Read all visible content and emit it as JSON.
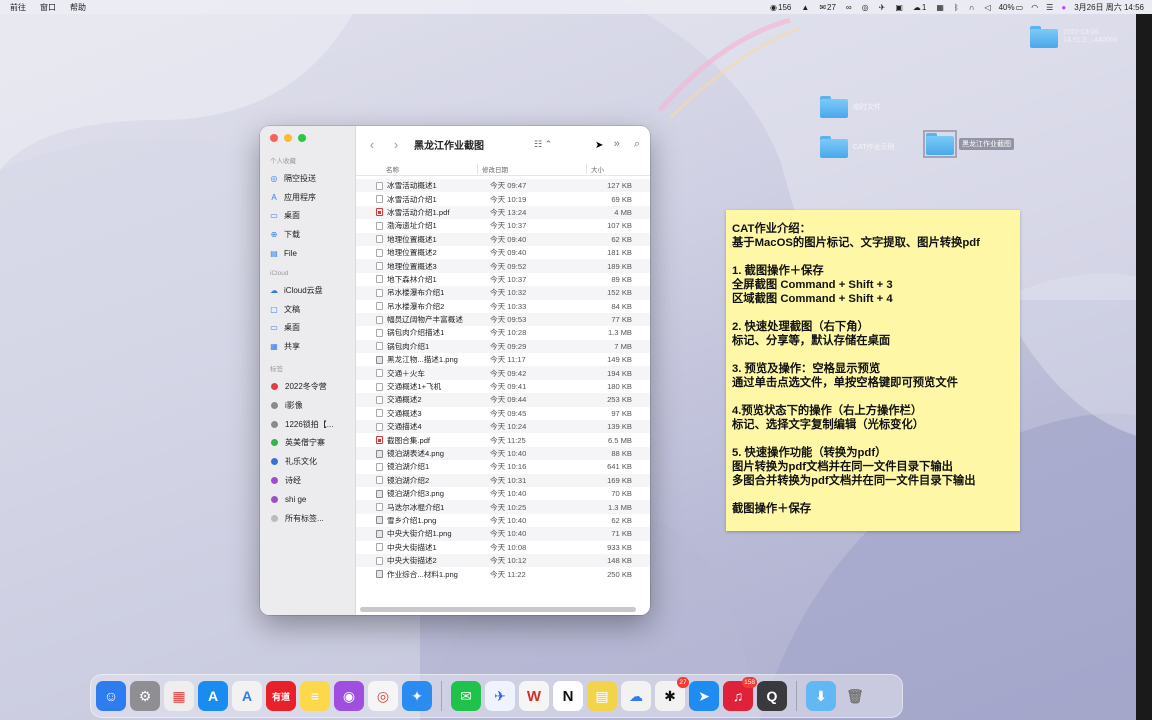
{
  "menubar": {
    "left": [
      "前往",
      "窗口",
      "帮助"
    ],
    "right": [
      {
        "icon": "media-icon",
        "text": "156"
      },
      {
        "icon": "bell-icon",
        "text": ""
      },
      {
        "icon": "mail-icon",
        "text": "27"
      },
      {
        "icon": "link-icon",
        "text": ""
      },
      {
        "icon": "record-icon",
        "text": ""
      },
      {
        "icon": "bird-icon",
        "text": ""
      },
      {
        "icon": "gamepad-icon",
        "text": ""
      },
      {
        "icon": "chat-icon",
        "text": "1"
      },
      {
        "icon": "screen-icon",
        "text": ""
      },
      {
        "icon": "bluetooth-icon",
        "text": ""
      },
      {
        "icon": "headphones-icon",
        "text": ""
      },
      {
        "icon": "volume-icon",
        "text": ""
      }
    ],
    "battery": "40%",
    "datetime": "3月26日 周六  14:56"
  },
  "desktop": {
    "top_folder": {
      "line1": "2022-03-26",
      "line2": "14.51.3....440060"
    },
    "folders": [
      "临时文件",
      "CAT作业示例",
      "黑龙江作业截图"
    ]
  },
  "finder": {
    "title": "黑龙江作业截图",
    "sidebar": {
      "favorites_header": "个人收藏",
      "favorites": [
        {
          "icon": "airdrop-icon",
          "label": "隔空投送"
        },
        {
          "icon": "applications-icon",
          "label": "应用程序"
        },
        {
          "icon": "desktop-icon",
          "label": "桌面"
        },
        {
          "icon": "downloads-icon",
          "label": "下载"
        },
        {
          "icon": "file-icon",
          "label": "File"
        }
      ],
      "icloud_header": "iCloud",
      "icloud": [
        {
          "icon": "cloud-icon",
          "label": "iCloud云盘"
        },
        {
          "icon": "documents-icon",
          "label": "文稿"
        },
        {
          "icon": "desktop-icon",
          "label": "桌面"
        },
        {
          "icon": "shared-icon",
          "label": "共享"
        }
      ],
      "tags_header": "标签",
      "tags": [
        {
          "color": "#e0413a",
          "label": "2022冬令营"
        },
        {
          "color": "#8a8a8a",
          "label": "i影像"
        },
        {
          "color": "#8a8a8a",
          "label": "1226锁拍【..."
        },
        {
          "color": "#35b24a",
          "label": "英美僧宁寨"
        },
        {
          "color": "#3a6fd8",
          "label": "礼乐文化"
        },
        {
          "color": "#9b4fd0",
          "label": "诗经"
        },
        {
          "color": "#9b4fd0",
          "label": "shi ge"
        },
        {
          "color": "#bbbbbb",
          "label": "所有标签..."
        }
      ]
    },
    "columns": {
      "name": "名称",
      "date": "修改日期",
      "size": "大小"
    },
    "files": [
      {
        "type": "doc",
        "name": "冰雪活动概述1",
        "date": "今天 09:47",
        "size": "127 KB"
      },
      {
        "type": "doc",
        "name": "冰雪活动介绍1",
        "date": "今天 10:19",
        "size": "69 KB"
      },
      {
        "type": "pdf",
        "name": "冰雪活动介绍1.pdf",
        "date": "今天 13:24",
        "size": "4 MB"
      },
      {
        "type": "doc",
        "name": "渤海遗址介绍1",
        "date": "今天 10:37",
        "size": "107 KB"
      },
      {
        "type": "doc",
        "name": "地理位置概述1",
        "date": "今天 09:40",
        "size": "62 KB"
      },
      {
        "type": "doc",
        "name": "地理位置概述2",
        "date": "今天 09:40",
        "size": "181 KB"
      },
      {
        "type": "doc",
        "name": "地理位置概述3",
        "date": "今天 09:52",
        "size": "189 KB"
      },
      {
        "type": "doc",
        "name": "地下森林介绍1",
        "date": "今天 10:37",
        "size": "89 KB"
      },
      {
        "type": "doc",
        "name": "吊水楼瀑布介绍1",
        "date": "今天 10:32",
        "size": "152 KB"
      },
      {
        "type": "doc",
        "name": "吊水楼瀑布介绍2",
        "date": "今天 10:33",
        "size": "84 KB"
      },
      {
        "type": "doc",
        "name": "幅员辽阔物产丰富概述",
        "date": "今天 09:53",
        "size": "77 KB"
      },
      {
        "type": "doc",
        "name": "锅包肉介绍描述1",
        "date": "今天 10:28",
        "size": "1.3 MB"
      },
      {
        "type": "doc",
        "name": "锅包肉介绍1",
        "date": "今天 09:29",
        "size": "7 MB"
      },
      {
        "type": "png",
        "name": "黑龙江物...描述1.png",
        "date": "今天 11:17",
        "size": "149 KB"
      },
      {
        "type": "doc",
        "name": "交通＋火车",
        "date": "今天 09:42",
        "size": "194 KB"
      },
      {
        "type": "doc",
        "name": "交通概述1+飞机",
        "date": "今天 09:41",
        "size": "180 KB"
      },
      {
        "type": "doc",
        "name": "交通概述2",
        "date": "今天 09:44",
        "size": "253 KB"
      },
      {
        "type": "doc",
        "name": "交通概述3",
        "date": "今天 09:45",
        "size": "97 KB"
      },
      {
        "type": "doc",
        "name": "交通描述4",
        "date": "今天 10:24",
        "size": "139 KB"
      },
      {
        "type": "pdf",
        "name": "截图合集.pdf",
        "date": "今天 11:25",
        "size": "6.5 MB"
      },
      {
        "type": "png",
        "name": "镜泊湖表述4.png",
        "date": "今天 10:40",
        "size": "88 KB"
      },
      {
        "type": "doc",
        "name": "镜泊湖介绍1",
        "date": "今天 10:16",
        "size": "641 KB"
      },
      {
        "type": "doc",
        "name": "镜泊湖介绍2",
        "date": "今天 10:31",
        "size": "169 KB"
      },
      {
        "type": "png",
        "name": "镜泊湖介绍3.png",
        "date": "今天 10:40",
        "size": "70 KB"
      },
      {
        "type": "doc",
        "name": "马迭尔冰棍介绍1",
        "date": "今天 10:25",
        "size": "1.3 MB"
      },
      {
        "type": "png",
        "name": "雪乡介绍1.png",
        "date": "今天 10:40",
        "size": "62 KB"
      },
      {
        "type": "png",
        "name": "中央大街介绍1.png",
        "date": "今天 10:40",
        "size": "71 KB"
      },
      {
        "type": "doc",
        "name": "中央大街描述1",
        "date": "今天 10:08",
        "size": "933 KB"
      },
      {
        "type": "doc",
        "name": "中央大街描述2",
        "date": "今天 10:12",
        "size": "148 KB"
      },
      {
        "type": "png",
        "name": "作业综合...材料1.png",
        "date": "今天 11:22",
        "size": "250 KB"
      }
    ]
  },
  "note": {
    "lines": [
      "CAT作业介绍：",
      "基于MacOS的图片标记、文字提取、图片转换pdf",
      "",
      "1. 截图操作＋保存",
      "全屏截图 Command + Shift + 3",
      "区域截图 Command + Shift + 4",
      "",
      "2. 快速处理截图（右下角）",
      "标记、分享等，默认存储在桌面",
      "",
      "3. 预览及操作：空格显示预览",
      "通过单击点选文件，单按空格键即可预览文件",
      "",
      "4.预览状态下的操作（右上方操作栏）",
      "标记、选择文字复制编辑（光标变化）",
      "",
      "5. 快速操作功能（转换为pdf）",
      "图片转换为pdf文档并在同一文件目录下输出",
      "多图合并转换为pdf文档并在同一文件目录下输出",
      "",
      "截图操作＋保存"
    ]
  },
  "dock": {
    "apps": [
      {
        "name": "finder-app",
        "label": "",
        "glyph": "☺",
        "bg": "#2f7bf0"
      },
      {
        "name": "system-preferences-app",
        "label": "",
        "glyph": "⚙",
        "bg": "#8e8e93"
      },
      {
        "name": "launchpad-app",
        "label": "",
        "glyph": "▦",
        "bg": "#eeeeee",
        "fg": "#e0413a"
      },
      {
        "name": "app-store-app",
        "label": "",
        "glyph": "A",
        "bg": "#1a8cf0"
      },
      {
        "name": "translator-app",
        "label": "",
        "glyph": "A",
        "bg": "#f2f2f2",
        "fg": "#2f7bf0"
      },
      {
        "name": "youdao-app",
        "label": "有道",
        "glyph": "",
        "bg": "#e7202a"
      },
      {
        "name": "notes-app",
        "label": "",
        "glyph": "≡",
        "bg": "#fbd94b",
        "fg": "#fff"
      },
      {
        "name": "podcasts-app",
        "label": "",
        "glyph": "◉",
        "bg": "#a04ee0"
      },
      {
        "name": "chrome-app",
        "label": "",
        "glyph": "◎",
        "bg": "#f5f5f5",
        "fg": "#e0413a"
      },
      {
        "name": "safari-app",
        "label": "",
        "glyph": "✦",
        "bg": "#2a8cf0"
      },
      {
        "sep": true
      },
      {
        "name": "wechat-app",
        "label": "",
        "glyph": "✉",
        "bg": "#1fc24a"
      },
      {
        "name": "feishu-app",
        "label": "",
        "glyph": "✈",
        "bg": "#eef3ff",
        "fg": "#2a5bd8"
      },
      {
        "name": "wps-app",
        "label": "W",
        "glyph": "",
        "bg": "#f5f5f5",
        "fg": "#d3302a"
      },
      {
        "name": "notion-app",
        "label": "N",
        "glyph": "",
        "bg": "#ffffff",
        "fg": "#111"
      },
      {
        "name": "stickies-app",
        "label": "",
        "glyph": "▤",
        "bg": "#f3d34a",
        "fg": "#fff"
      },
      {
        "name": "baidu-netdisk-app",
        "label": "",
        "glyph": "☁",
        "bg": "#f2f2f2",
        "fg": "#2f7bf0"
      },
      {
        "name": "qq-app",
        "label": "",
        "glyph": "✱",
        "bg": "#f2f2f2",
        "fg": "#111",
        "badge": "27"
      },
      {
        "name": "dingtalk-app",
        "label": "",
        "glyph": "➤",
        "bg": "#1e8cf0"
      },
      {
        "name": "netease-music-app",
        "label": "",
        "glyph": "♫",
        "bg": "#e0213a",
        "badge": "158"
      },
      {
        "name": "quicktime-app",
        "label": "",
        "glyph": "Q",
        "bg": "#3a3a3e"
      },
      {
        "sep": true
      },
      {
        "name": "downloads-folder",
        "label": "",
        "glyph": "⬇",
        "bg": "#63b7f2"
      },
      {
        "name": "trash-app",
        "label": "",
        "glyph": "🗑",
        "bg": "transparent",
        "fg": "#777"
      }
    ]
  }
}
